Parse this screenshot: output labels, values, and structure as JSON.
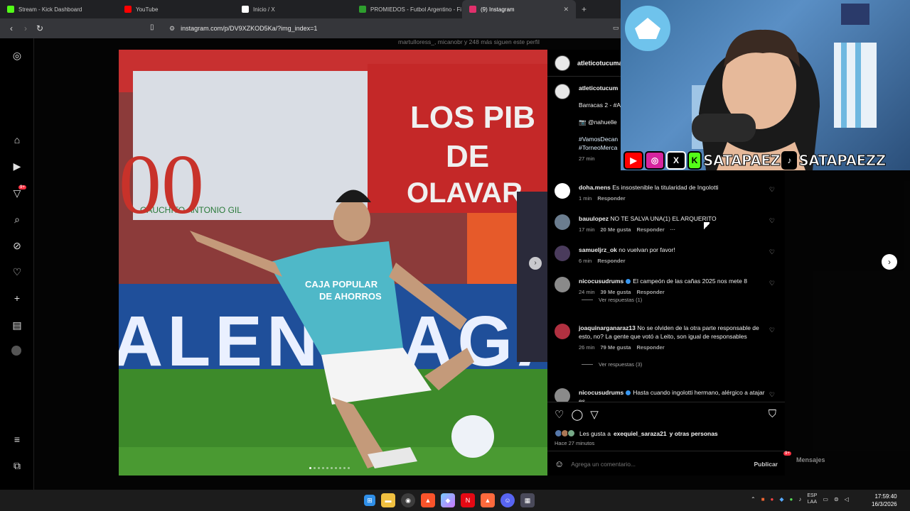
{
  "tabs": [
    {
      "title": "Stream - Kick Dashboard",
      "color": "#53fc18"
    },
    {
      "title": "YouTube",
      "color": "#ff0000"
    },
    {
      "title": "Inicio / X",
      "color": "#ffffff"
    },
    {
      "title": "PROMIEDOS - Futbol Argentino - Fi",
      "color": "#2e9e2e"
    },
    {
      "title": "(9) Instagram",
      "color": "#e1306c",
      "active": true
    }
  ],
  "url": "instagram.com/p/DV9XZKOD5Ka/?img_index=1",
  "behind_text": "martulloress_, micanobr y 248 más siguen este perfil",
  "post": {
    "username": "atleticotucuma",
    "caption_user": "atleticotucum",
    "caption_line1": "Barracas 2 - #A",
    "caption_line2": "📷 @nahuelle",
    "caption_tags1": "#VamosDecan",
    "caption_tags2": "#TorneoMerca",
    "caption_time": "27 min"
  },
  "comments": [
    {
      "user": "doha.mens",
      "text": "Es insostenible la titularidad de Ingolotti",
      "time": "1 min",
      "likes": "",
      "reply": "Responder",
      "avatar": "#ffffff"
    },
    {
      "user": "bauulopez",
      "text": "NO TE SALVA UNA(1) EL ARQUERITO",
      "time": "17 min",
      "likes": "20 Me gusta",
      "reply": "Responder",
      "more": "···",
      "avatar": "#6b7d8f"
    },
    {
      "user": "samueljrz_ok",
      "text": "no vuelvan por favor!",
      "time": "6 min",
      "likes": "",
      "reply": "Responder",
      "avatar": "#4a3b5c"
    },
    {
      "user": "nicocusudrums",
      "text": "El campeón de las cañas 2025 nos mete 8",
      "time": "24 min",
      "likes": "39 Me gusta",
      "reply": "Responder",
      "avatar": "#8a8a8a",
      "verified": true
    },
    {
      "user": "joaquinarganaraz13",
      "text": "No se olviden de la otra parte responsable de esto, no? La gente que votó a Leito, son igual de responsables",
      "time": "26 min",
      "likes": "79 Me gusta",
      "reply": "Responder",
      "avatar": "#b03040"
    },
    {
      "user": "nicocusudrums",
      "text": "Hasta cuando ingolotti hermano, alérgico a atajar es",
      "time": "",
      "likes": "",
      "reply": "",
      "avatar": "#8a8a8a",
      "verified": true
    }
  ],
  "view_replies_1": "Ver respuestas (1)",
  "view_replies_2": "Ver respuestas (3)",
  "likes_text": "Les gusta a",
  "likes_user": "exequiel_saraza21",
  "likes_others": "y otras personas",
  "posted_ago": "Hace 27 minutos",
  "comment_placeholder": "Agrega un comentario...",
  "publish_label": "Publicar",
  "messages_label": "Mensajes",
  "messages_badge": "9+",
  "notif_badge": "9+",
  "photo_text": {
    "banner": "LOS PIB\nDE\nOLAVAR",
    "banner2": "GAUCHITO ANTONIO GIL",
    "board": "ALENCIAGA",
    "shirt": "CAJA POPULAR DE AHORROS"
  },
  "stream_handles": [
    "SATAPAEZ",
    "SATAPAEZZ"
  ],
  "taskbar": {
    "lang1": "ESP",
    "lang2": "LAA",
    "time": "17:59:40",
    "date": "16/3/2026"
  }
}
